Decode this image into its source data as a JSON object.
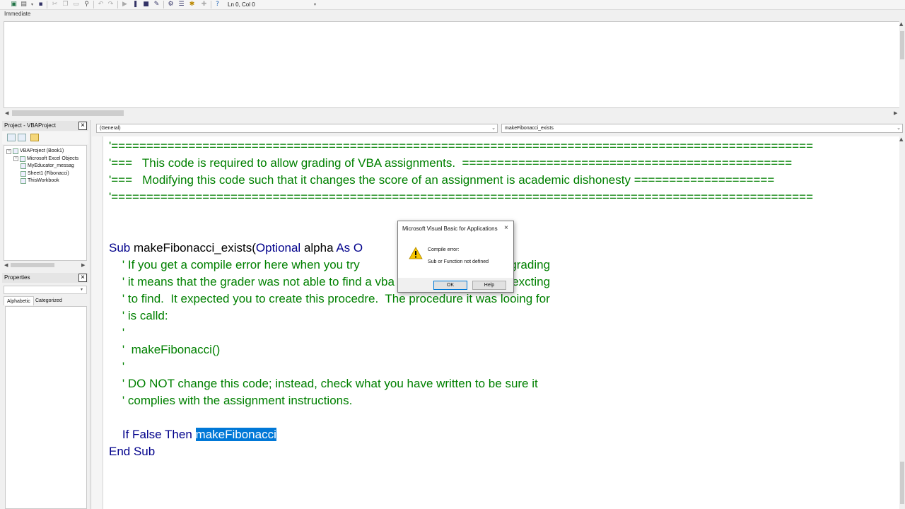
{
  "toolbar": {
    "status": "Ln 0, Col 0",
    "buttons": [
      "excel-icon",
      "insert-icon",
      "dropdown-arrow-icon",
      "save-icon",
      "cut-icon",
      "copy-icon",
      "paste-icon",
      "find-icon",
      "undo-icon",
      "redo-icon",
      "run-icon",
      "break-icon",
      "reset-icon",
      "design-mode-icon",
      "project-explorer-icon",
      "properties-icon",
      "object-browser-icon",
      "toolbox-icon",
      "help-icon"
    ]
  },
  "immediate": {
    "title": "Immediate"
  },
  "project": {
    "title": "Project - VBAProject",
    "tree": [
      {
        "label": "VBAProject (Book1)",
        "level": 0,
        "twisty": "−"
      },
      {
        "label": "Microsoft Excel Objects",
        "level": 1,
        "twisty": "−"
      },
      {
        "label": "MyEducator_messag",
        "level": 2,
        "twisty": ""
      },
      {
        "label": "Sheet1 (Fibonacci)",
        "level": 2,
        "twisty": ""
      },
      {
        "label": "ThisWorkbook",
        "level": 2,
        "twisty": ""
      }
    ]
  },
  "properties": {
    "title": "Properties",
    "tabs": [
      "Alphabetic",
      "Categorized"
    ]
  },
  "code": {
    "object_combo": "(General)",
    "proc_combo": "makeFibonacci_exists",
    "lines": [
      {
        "segments": [
          {
            "text": "'====================================================================================================",
            "color": "green"
          }
        ]
      },
      {
        "segments": [
          {
            "text": "'===   This code is required to allow grading of VBA assignments.  ===============================================",
            "color": "green"
          }
        ]
      },
      {
        "segments": [
          {
            "text": "'===   Modifying this code such that it changes the score of an assignment is academic dishonesty ====================",
            "color": "green"
          }
        ]
      },
      {
        "segments": [
          {
            "text": "'====================================================================================================",
            "color": "green"
          }
        ]
      },
      {
        "segments": []
      },
      {
        "segments": []
      },
      {
        "segments": [
          {
            "text": "Sub ",
            "color": "blue"
          },
          {
            "text": "makeFibonacci_exists(",
            "color": "black"
          },
          {
            "text": "Optional ",
            "color": "blue"
          },
          {
            "text": "alpha ",
            "color": "black"
          },
          {
            "text": "As ",
            "color": "blue"
          },
          {
            "text": "O",
            "color": "blue"
          }
        ]
      },
      {
        "segments": [
          {
            "text": "    ' If you get a compile error here when you try",
            "color": "green"
          },
          {
            "text": "                               ution for grading",
            "color": "green"
          }
        ]
      },
      {
        "segments": [
          {
            "text": "    ' it means that the grader was not able to find a vba sub procedure it was excting",
            "color": "green"
          }
        ]
      },
      {
        "segments": [
          {
            "text": "    ' to find.  It expected you to create this procedre.  The procedure it was looing for",
            "color": "green"
          }
        ]
      },
      {
        "segments": [
          {
            "text": "    ' is calld:",
            "color": "green"
          }
        ]
      },
      {
        "segments": [
          {
            "text": "    '",
            "color": "green"
          }
        ]
      },
      {
        "segments": [
          {
            "text": "    '  makeFibonacci()",
            "color": "green"
          }
        ]
      },
      {
        "segments": [
          {
            "text": "    '",
            "color": "green"
          }
        ]
      },
      {
        "segments": [
          {
            "text": "    ' DO NOT change this code; instead, check what you have written to be sure it",
            "color": "green"
          }
        ]
      },
      {
        "segments": [
          {
            "text": "    ' complies with the assignment instructions.",
            "color": "green"
          }
        ]
      },
      {
        "segments": []
      },
      {
        "segments": [
          {
            "text": "    If False Then ",
            "color": "blue"
          },
          {
            "text": "makeFibonacci",
            "color": "selected"
          }
        ]
      },
      {
        "segments": [
          {
            "text": "End Sub",
            "color": "blue"
          }
        ]
      }
    ]
  },
  "dialog": {
    "title": "Microsoft Visual Basic for Applications",
    "icon": "warning-icon",
    "message_heading": "Compile error:",
    "message_body": "Sub or Function not defined",
    "ok_label": "OK",
    "help_label": "Help"
  },
  "colors": {
    "comment": "#008000",
    "keyword": "#00008b",
    "selection": "#0078d7"
  }
}
